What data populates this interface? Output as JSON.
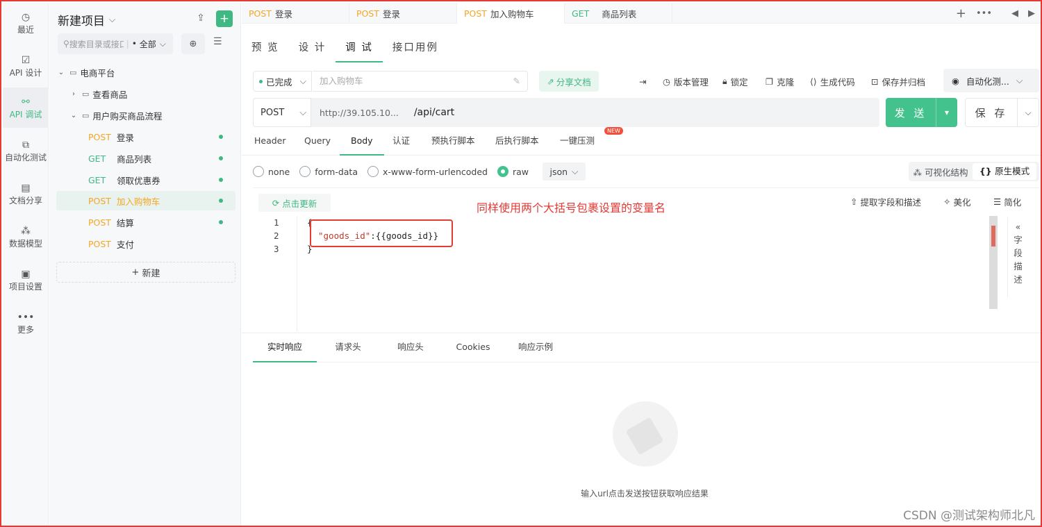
{
  "rail": [
    {
      "icon": "clock-icon",
      "glyph": "◷",
      "label": "最近"
    },
    {
      "icon": "edit-icon",
      "glyph": "☑",
      "label": "API 设计"
    },
    {
      "icon": "link-icon",
      "glyph": "⚯",
      "label": "API 调试",
      "active": true
    },
    {
      "icon": "flow-icon",
      "glyph": "⧉",
      "label": "自动化测试"
    },
    {
      "icon": "doc-icon",
      "glyph": "▤",
      "label": "文档分享"
    },
    {
      "icon": "model-icon",
      "glyph": "⁂",
      "label": "数据模型"
    },
    {
      "icon": "settings-folder-icon",
      "glyph": "▣",
      "label": "项目设置"
    },
    {
      "icon": "more-icon",
      "glyph": "•••",
      "label": "更多"
    }
  ],
  "project": {
    "title": "新建项目",
    "search_placeholder": "搜索目录或接口",
    "scope": "全部",
    "new_label": "新建"
  },
  "tree": [
    {
      "type": "folder",
      "label": "电商平台",
      "open": true,
      "depth": 0
    },
    {
      "type": "folder",
      "label": "查看商品",
      "open": false,
      "depth": 1
    },
    {
      "type": "folder",
      "label": "用户购买商品流程",
      "open": true,
      "depth": 1
    },
    {
      "type": "api",
      "method": "POST",
      "label": "登录",
      "done": true
    },
    {
      "type": "api",
      "method": "GET",
      "label": "商品列表",
      "done": true
    },
    {
      "type": "api",
      "method": "GET",
      "label": "领取优惠券",
      "done": true
    },
    {
      "type": "api",
      "method": "POST",
      "label": "加入购物车",
      "done": true,
      "selected": true
    },
    {
      "type": "api",
      "method": "POST",
      "label": "结算",
      "done": true
    },
    {
      "type": "api",
      "method": "POST",
      "label": "支付",
      "done": false
    }
  ],
  "tabs": [
    {
      "method": "POST",
      "label": "登录"
    },
    {
      "method": "POST",
      "label": "登录"
    },
    {
      "method": "POST",
      "label": "加入购物车",
      "active": true
    },
    {
      "method": "GET",
      "label": "商品列表"
    }
  ],
  "subtabs": [
    "预 览",
    "设 计",
    "调 试",
    "接口用例"
  ],
  "toolbar": {
    "status": "已完成",
    "name_placeholder": "加入购物车",
    "share": "分享文档",
    "version": "版本管理",
    "lock": "锁定",
    "clone": "克隆",
    "gen_code": "生成代码",
    "save_archive": "保存并归档",
    "auto": "自动化测..."
  },
  "request": {
    "method": "POST",
    "base_url": "http://39.105.10...",
    "path": "/api/cart",
    "send": "发 送",
    "save": "保 存"
  },
  "req_tabs": [
    "Header",
    "Query",
    "Body",
    "认证",
    "预执行脚本",
    "后执行脚本",
    "一键压测"
  ],
  "new_badge": "NEW",
  "body_types": [
    "none",
    "form-data",
    "x-www-form-urlencoded",
    "raw"
  ],
  "body_format": "json",
  "modes": {
    "visual": "可视化结构",
    "raw": "原生模式"
  },
  "editor": {
    "update": "点击更新",
    "annotation": "同样使用两个大括号包裹设置的变量名",
    "extract": "提取字段和描述",
    "beautify": "美化",
    "simplify": "简化",
    "lines": [
      "1",
      "2",
      "3"
    ],
    "open_brace": "{",
    "key": "\"goods_id\"",
    "value": ":{{goods_id}}",
    "close_brace": "}",
    "field_desc": [
      "«",
      "字",
      "段",
      "描",
      "述"
    ]
  },
  "response": {
    "tabs": [
      "实时响应",
      "请求头",
      "响应头",
      "Cookies",
      "响应示例"
    ],
    "empty": "输入url点击发送按钮获取响应结果"
  },
  "watermark": "CSDN @测试架构师北凡",
  "colors": {
    "accent": "#3fb883",
    "post": "#f5a623",
    "annotation": "#e53935"
  }
}
